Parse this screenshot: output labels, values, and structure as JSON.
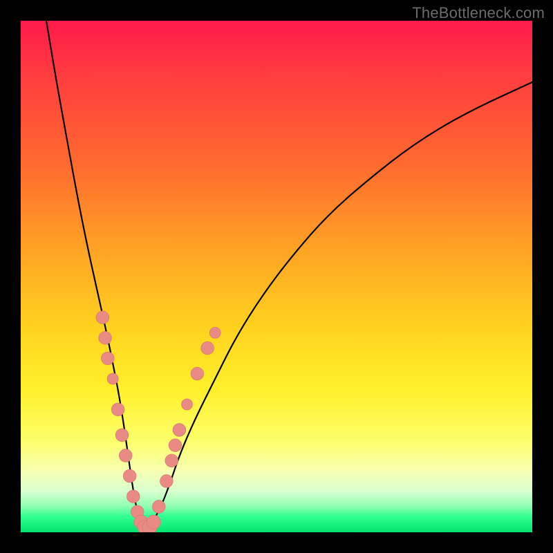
{
  "watermark": "TheBottleneck.com",
  "colors": {
    "frame": "#000000",
    "curve_stroke": "#000000",
    "marker_fill": "#e98b84",
    "marker_stroke": "#d97a72",
    "gradient_stops": [
      "#ff1a4b",
      "#ff3b3f",
      "#ff6a2f",
      "#ffa424",
      "#ffd21f",
      "#fff02a",
      "#fdff6a",
      "#f6ffb0",
      "#d8ffcf",
      "#8dffb1",
      "#2fff8f",
      "#00e56f"
    ]
  },
  "chart_data": {
    "type": "line",
    "title": "",
    "xlabel": "",
    "ylabel": "",
    "xlim": [
      0,
      100
    ],
    "ylim": [
      0,
      100
    ],
    "grid": false,
    "series": [
      {
        "name": "bottleneck-curve",
        "x": [
          5,
          7,
          9,
          11,
          13,
          15,
          17,
          18,
          19,
          20,
          21,
          22,
          23,
          24,
          25,
          27,
          29,
          31,
          34,
          38,
          42,
          47,
          53,
          60,
          68,
          77,
          87,
          100
        ],
        "y": [
          100,
          88,
          77,
          66,
          56,
          47,
          38,
          33,
          28,
          22,
          15,
          8,
          3,
          1,
          1,
          4,
          9,
          15,
          22,
          30,
          38,
          46,
          54,
          62,
          69,
          76,
          82,
          88
        ]
      }
    ],
    "markers": [
      {
        "x": 16.0,
        "y": 42,
        "r": 1.4
      },
      {
        "x": 16.5,
        "y": 38,
        "r": 1.4
      },
      {
        "x": 17.0,
        "y": 34,
        "r": 1.4
      },
      {
        "x": 18.0,
        "y": 30,
        "r": 1.2
      },
      {
        "x": 19.0,
        "y": 24,
        "r": 1.4
      },
      {
        "x": 19.8,
        "y": 19,
        "r": 1.4
      },
      {
        "x": 20.5,
        "y": 15,
        "r": 1.4
      },
      {
        "x": 21.3,
        "y": 11,
        "r": 1.4
      },
      {
        "x": 22.0,
        "y": 7,
        "r": 1.4
      },
      {
        "x": 22.8,
        "y": 4,
        "r": 1.4
      },
      {
        "x": 23.5,
        "y": 2,
        "r": 1.5
      },
      {
        "x": 24.3,
        "y": 1,
        "r": 1.6
      },
      {
        "x": 25.2,
        "y": 1,
        "r": 1.6
      },
      {
        "x": 26.0,
        "y": 2,
        "r": 1.5
      },
      {
        "x": 27.0,
        "y": 5,
        "r": 1.4
      },
      {
        "x": 28.5,
        "y": 10,
        "r": 1.4
      },
      {
        "x": 29.5,
        "y": 14,
        "r": 1.4
      },
      {
        "x": 30.2,
        "y": 17,
        "r": 1.4
      },
      {
        "x": 31.0,
        "y": 20,
        "r": 1.4
      },
      {
        "x": 32.5,
        "y": 25,
        "r": 1.2
      },
      {
        "x": 34.5,
        "y": 31,
        "r": 1.4
      },
      {
        "x": 36.5,
        "y": 36,
        "r": 1.4
      },
      {
        "x": 38.0,
        "y": 39,
        "r": 1.2
      }
    ]
  }
}
